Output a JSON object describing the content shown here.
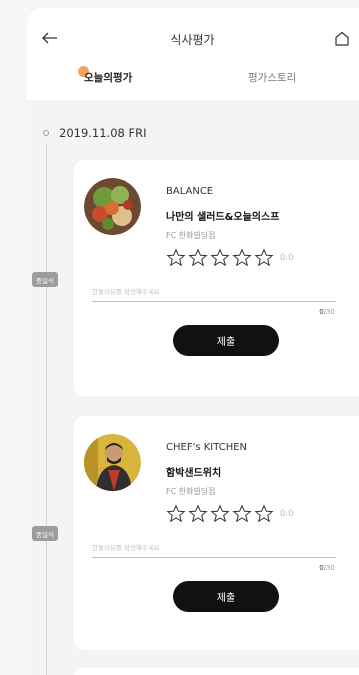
{
  "header": {
    "title": "식사평가",
    "back_icon": "arrow-left-icon",
    "home_icon": "home-icon"
  },
  "tabs": [
    {
      "label": "오늘의평가",
      "active": true
    },
    {
      "label": "평가스토리",
      "active": false
    }
  ],
  "date": "2019.11.08 FRI",
  "meals": [
    {
      "meal_tag": "중일식",
      "brand": "BALANCE",
      "menu": "나만의 샐러드&오늘의스프",
      "location": "FC 한화빌딩점",
      "rating": 0,
      "score_text": "0.0",
      "review_placeholder": "한줄리뷰를 작성해주세요",
      "char_count": "0",
      "char_max": "/30",
      "submit_label": "제출",
      "photo": "salad-photo"
    },
    {
      "meal_tag": "중일식",
      "brand": "CHEF's KITCHEN",
      "menu": "함박샌드위치",
      "location": "FC 한화빌딩점",
      "rating": 0,
      "score_text": "0.0",
      "review_placeholder": "한줄리뷰를 작성해주세요",
      "char_count": "0",
      "char_max": "/30",
      "submit_label": "제출",
      "photo": "chef-photo"
    }
  ],
  "colors": {
    "accent_dot": "#f2a365",
    "button": "#111111",
    "meal_tag": "#9c9c9c"
  }
}
